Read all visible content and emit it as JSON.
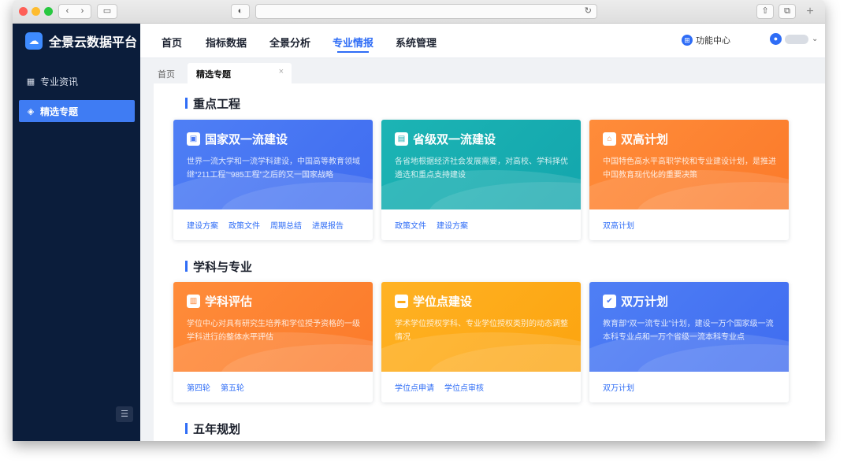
{
  "browser": {
    "nav_back": "‹",
    "nav_forward": "›",
    "sidebar_toggle": "▭",
    "shield": "◐",
    "reload": "↻",
    "share": "⇧",
    "tabs": "⧉",
    "new_tab": "+"
  },
  "brand": {
    "name": "全景云数据平台",
    "logo_glyph": "☁"
  },
  "sidebar": {
    "items": [
      {
        "label": "专业资讯",
        "icon": "news-icon",
        "glyph": "▦"
      },
      {
        "label": "精选专题",
        "icon": "topic-icon",
        "glyph": "◈"
      }
    ],
    "collapse_glyph": "☰"
  },
  "topnav": {
    "items": [
      "首页",
      "指标数据",
      "全景分析",
      "专业情报",
      "系统管理"
    ],
    "active": "专业情报",
    "function_center": "功能中心",
    "func_glyph": "⊞",
    "user_glyph": "●",
    "chevron": "⌄"
  },
  "tabs": {
    "home": "首页",
    "active": "精选专题",
    "close": "×"
  },
  "sections": [
    {
      "title": "重点工程",
      "cards": [
        {
          "title": "国家双一流建设",
          "icon": "book-icon",
          "glyph": "▣",
          "color": "#4a7af4",
          "desc": "世界一流大学和一流学科建设，中国高等教育领域继“211工程”“985工程”之后的又一国家战略",
          "links": [
            "建设方案",
            "政策文件",
            "周期总结",
            "进展报告"
          ]
        },
        {
          "title": "省级双一流建设",
          "icon": "doc-icon",
          "glyph": "▤",
          "color": "#17aeb0",
          "desc": "各省地根据经济社会发展需要，对高校、学科择优遴选和重点支持建设",
          "links": [
            "政策文件",
            "建设方案"
          ]
        },
        {
          "title": "双高计划",
          "icon": "home-icon",
          "glyph": "⌂",
          "color": "#fd8434",
          "desc": "中国特色高水平高职学校和专业建设计划，是推进中国教育现代化的重要决策",
          "links": [
            "双高计划"
          ]
        }
      ]
    },
    {
      "title": "学科与专业",
      "cards": [
        {
          "title": "学科评估",
          "icon": "institution-icon",
          "glyph": "▥",
          "color": "#fd8434",
          "desc": "学位中心对具有研究生培养和学位授予资格的一级学科进行的整体水平评估",
          "links": [
            "第四轮",
            "第五轮"
          ]
        },
        {
          "title": "学位点建设",
          "icon": "certificate-icon",
          "glyph": "▬",
          "color": "#fdab1a",
          "desc": "学术学位授权学科、专业学位授权类别的动态调整情况",
          "links": [
            "学位点申请",
            "学位点审核"
          ]
        },
        {
          "title": "双万计划",
          "icon": "shield-check-icon",
          "glyph": "✔",
          "color": "#4a7af4",
          "desc": "教育部“双一流专业”计划，建设一万个国家级一流本科专业点和一万个省级一流本科专业点",
          "links": [
            "双万计划"
          ]
        }
      ]
    },
    {
      "title": "五年规划",
      "cards": []
    }
  ]
}
